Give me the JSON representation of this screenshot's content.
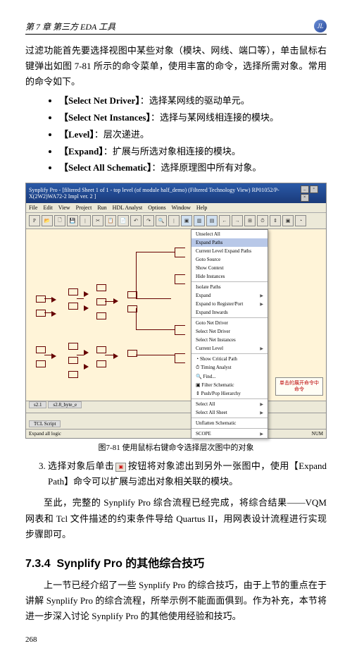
{
  "header": {
    "chapter": "第 7 章  第三方 EDA 工具"
  },
  "intro": {
    "p1": "过滤功能首先要选择视图中某些对象（模块、网线、端口等），单击鼠标右键弹出如图 7-81 所示的命令菜单，使用丰富的命令，选择所需对象。常用的命令如下。"
  },
  "bullets": [
    {
      "cmd": "【Select Net Driver】",
      "desc": "：选择某网线的驱动单元。"
    },
    {
      "cmd": "【Select Net Instances】",
      "desc": "：选择与某网线相连接的模块。"
    },
    {
      "cmd": "【Level】",
      "desc": "：层次递进。"
    },
    {
      "cmd": "【Expand】",
      "desc": "：扩展与所选对象相连接的模块。"
    },
    {
      "cmd": "【Select All Schematic】",
      "desc": "：选择原理图中所有对象。"
    }
  ],
  "screenshot": {
    "title": "Synplify Pro - [filtered Sheet 1 of 1 - top level (of module half_demo) (Filtered Technology View)  RP01052/P-X(2W2)WA72-2 Impl ver. 2 ]",
    "menubar": [
      "File",
      "Edit",
      "View",
      "Project",
      "Run",
      "HDL Analyst",
      "Options",
      "Window",
      "Help"
    ],
    "tabs": [
      "s2.1",
      "s2.8_byte_e"
    ],
    "logtab": "TCL Script",
    "status_left": "Expand all logic",
    "status_right": "NUM",
    "ctxmenu": [
      {
        "t": "Unselect All",
        "arrow": false
      },
      {
        "t": "Expand Paths",
        "arrow": false,
        "hl": true
      },
      {
        "t": "Current Level Expand Paths",
        "arrow": false
      },
      {
        "t": "Goto Source",
        "arrow": false
      },
      {
        "t": "Show Context",
        "arrow": false
      },
      {
        "t": "Hide Instances",
        "arrow": false
      },
      {
        "sep": true
      },
      {
        "t": "Isolate Paths",
        "arrow": false
      },
      {
        "t": "Expand",
        "arrow": true
      },
      {
        "t": "Expand to Register/Port",
        "arrow": true
      },
      {
        "t": "Expand Inwards",
        "arrow": false
      },
      {
        "sep": true
      },
      {
        "t": "Goto Net Driver",
        "arrow": false
      },
      {
        "t": "Select Net Driver",
        "arrow": false
      },
      {
        "t": "Select Net Instances",
        "arrow": false
      },
      {
        "t": "Current Level",
        "arrow": true
      },
      {
        "sep": true
      },
      {
        "t": "Show Critical Path",
        "arrow": false,
        "ico": "◔"
      },
      {
        "t": "Timing Analyst",
        "arrow": false,
        "ico": "⏱"
      },
      {
        "t": "Find...",
        "arrow": false,
        "ico": "🔍"
      },
      {
        "t": "Filter Schematic",
        "arrow": false,
        "ico": "▣"
      },
      {
        "t": "Push/Pop Hierarchy",
        "arrow": false,
        "ico": "⇕"
      },
      {
        "sep": true
      },
      {
        "t": "Select All",
        "arrow": true
      },
      {
        "t": "Select All Sheet",
        "arrow": true
      },
      {
        "sep": true
      },
      {
        "t": "Unflatten Schematic",
        "arrow": false
      },
      {
        "sep": true
      },
      {
        "t": "SCOPE",
        "arrow": true
      }
    ],
    "callout": "单击的展开命令中命令"
  },
  "caption": "图7-81  使用鼠标右键命令选择层次图中的对象",
  "numlist": {
    "start": 3,
    "text_before": "选择对象后单击",
    "text_after": "按钮将对象滤出到另外一张图中，使用【",
    "cmd": "Expand Path",
    "text_end": "】命令可以扩展与滤出对象相关联的模块。"
  },
  "after": {
    "p": "至此，完整的 Synplify Pro 综合流程已经完成，将综合结果——VQM 网表和 Tcl 文件描述的约束条件导给 Quartus II，用网表设计流程进行实现步骤即可。"
  },
  "section": {
    "num": "7.3.4",
    "title": "Synplify Pro 的其他综合技巧"
  },
  "sec_body": {
    "p": "上一节已经介绍了一些 Synplify Pro 的综合技巧，由于上节的重点在于讲解 Synplify Pro 的综合流程，所举示例不能面面俱到。作为补充，本节将进一步深入讨论 Synplify Pro 的其他使用经验和技巧。"
  },
  "pagenum": "268"
}
